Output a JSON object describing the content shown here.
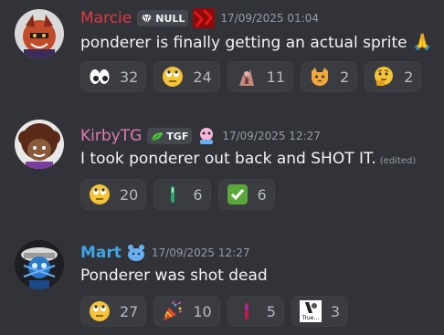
{
  "messages": [
    {
      "username": "Marcie",
      "name_color": "#e0373f",
      "tag": "NULL",
      "tag_icon": "gem-icon",
      "timestamp": "17/09/2025 01:04",
      "text": "ponderer is finally getting an actual sprite",
      "text_emoji": "🙏",
      "reactions": [
        {
          "icon": "eyes-emoji",
          "glyph": "👀",
          "count": "32"
        },
        {
          "icon": "rolling-eyes-emoji",
          "glyph": "🙄",
          "count": "24"
        },
        {
          "icon": "custom-sprite-emoji",
          "glyph": "",
          "count": "11"
        },
        {
          "icon": "cat-emoji",
          "glyph": "🐱",
          "count": "2"
        },
        {
          "icon": "thinking-emoji",
          "glyph": "🤔",
          "count": "2"
        }
      ]
    },
    {
      "username": "KirbyTG",
      "name_color": "#e07ab1",
      "tag": "TGF",
      "tag_icon": "leaf-icon",
      "timestamp": "17/09/2025 12:27",
      "text": "I took ponderer out back and SHOT IT.",
      "edited": "(edited)",
      "reactions": [
        {
          "icon": "rolling-eyes-emoji",
          "glyph": "🙄",
          "count": "20"
        },
        {
          "icon": "custom-green-bar-emoji",
          "glyph": "",
          "count": "6"
        },
        {
          "icon": "check-mark-emoji",
          "glyph": "✅",
          "count": "6"
        }
      ]
    },
    {
      "username": "Mart",
      "name_color": "#3ea5e6",
      "timestamp": "17/09/2025 12:27",
      "text": "Ponderer was shot dead",
      "reactions": [
        {
          "icon": "rolling-eyes-emoji",
          "glyph": "🙄",
          "count": "27"
        },
        {
          "icon": "party-popper-emoji",
          "glyph": "🎉",
          "count": "10"
        },
        {
          "icon": "custom-red-bar-emoji",
          "glyph": "",
          "count": "5"
        },
        {
          "icon": "true-meme-emoji",
          "glyph": "",
          "label": "True...",
          "count": "3"
        }
      ]
    }
  ]
}
